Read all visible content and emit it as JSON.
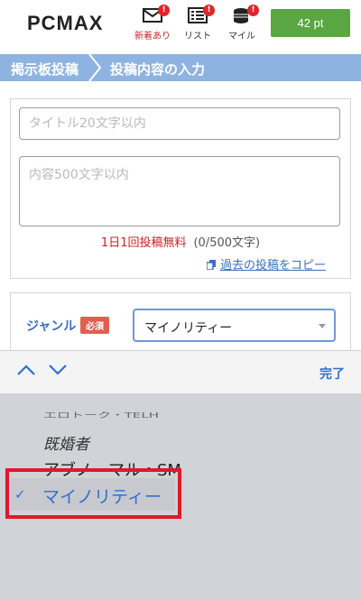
{
  "header": {
    "logo": "PCMAX",
    "icons": [
      {
        "icon": "mail-icon",
        "label": "新着あり",
        "badge": "!"
      },
      {
        "icon": "list-icon",
        "label": "リスト",
        "badge": "!"
      },
      {
        "icon": "coins-icon",
        "label": "マイル",
        "badge": "!"
      }
    ],
    "points": "42 pt"
  },
  "breadcrumb": {
    "parent": "掲示板投稿",
    "current": "投稿内容の入力"
  },
  "form": {
    "title_placeholder": "タイトル20文字以内",
    "body_placeholder": "内容500文字以内",
    "free_note": "1日1回投稿無料",
    "char_count": "(0/500文字)",
    "copy_link": "過去の投稿をコピー"
  },
  "genre": {
    "label": "ジャンル",
    "required": "必須",
    "value": "マイノリティー"
  },
  "accessory": {
    "done": "完了"
  },
  "picker": {
    "options": [
      "エロトーク・TELH",
      "既婚者",
      "アブノーマル・SM",
      "マイノリティー"
    ],
    "selected_index": 3
  },
  "colors": {
    "accent_blue": "#3a6fc0",
    "points_green": "#5aa642",
    "breadcrumb": "#8fb3e0",
    "highlight_red": "#e0192a"
  }
}
